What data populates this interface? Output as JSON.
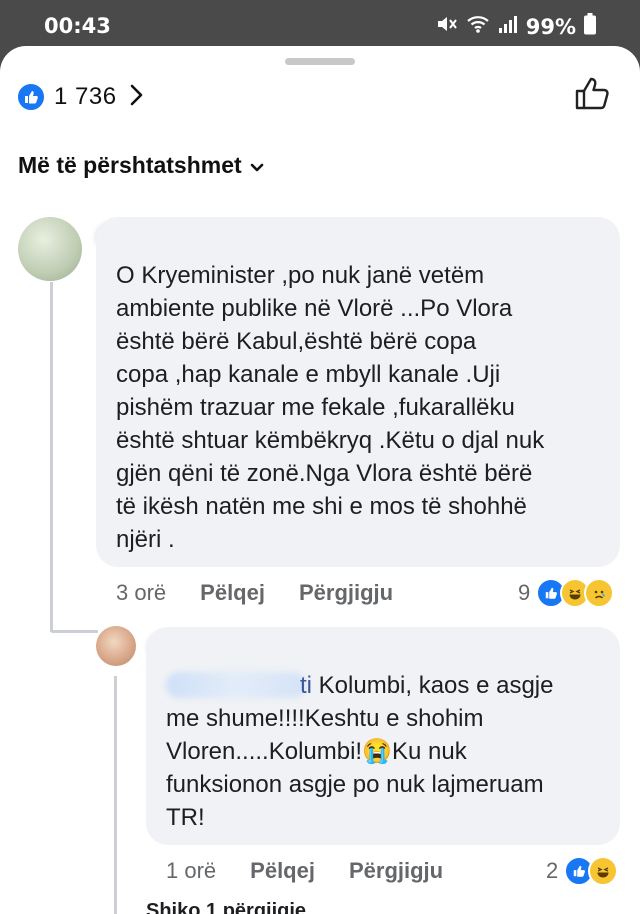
{
  "status_bar": {
    "time": "00:43",
    "battery": "99%"
  },
  "header": {
    "reaction_count": "1 736",
    "sort_label": "Më të përshtatshmet"
  },
  "comments": [
    {
      "text": "O Kryeminister ,po nuk janë vetëm\nambiente publike në Vlorë ...Po Vlora\nështë bërë Kabul,është bërë copa\ncopa ,hap  kanale e mbyll kanale .Uji\npishëm trazuar me fekale ,fukarallëku\nështë shtuar këmbëkryq .Këtu o djal nuk\ngjën qëni të zonë.Nga Vlora është bërë\ntë ikësh natën me shi e mos të shohhë\nnjëri .",
      "time": "3 orë",
      "like_label": "Pëlqej",
      "reply_label": "Përgjigju",
      "reaction_count": "9"
    },
    {
      "mention_tail": "ti",
      "text": " Kolumbi, kaos e asgje\nme shume!!!!Keshtu e shohim\nVloren.....Kolumbi!😭Ku nuk\nfunksionon asgje po nuk lajmeruam\nTR!",
      "time": "1 orë",
      "like_label": "Pëlqej",
      "reply_label": "Përgjigju",
      "reaction_count": "2"
    }
  ],
  "view_replies": "Shiko 1 përgjigje",
  "colors": {
    "accent": "#1877f2",
    "bubble": "#f0f2f5",
    "meta": "#65676b"
  },
  "icons": [
    "mute-icon",
    "wifi-icon",
    "signal-icon",
    "battery-icon",
    "like-badge-icon",
    "chevron-right-icon",
    "thumbs-up-icon",
    "chevron-down-icon",
    "haha-emoji-icon",
    "sad-emoji-icon"
  ]
}
